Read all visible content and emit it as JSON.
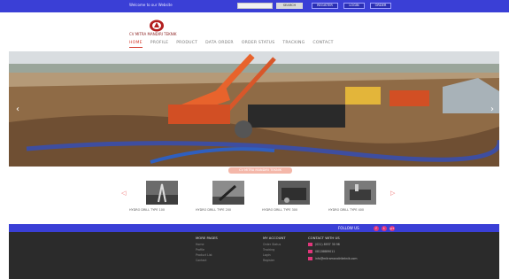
{
  "topbar": {
    "welcome": "Welcome to our Website",
    "search_placeholder": "",
    "search_button": "SEARCH",
    "links": [
      "REGISTER",
      "LOGIN",
      "ORDER"
    ]
  },
  "header": {
    "company": "CV MITRA MANDIRI TEKNIK",
    "nav": [
      "HOME",
      "PROFILE",
      "PRODUCT",
      "DATA ORDER",
      "ORDER STATUS",
      "TRACKING",
      "CONTACT"
    ]
  },
  "slider": {
    "prev_icon": "‹",
    "next_icon": "›",
    "caption": "CV MITRA MANDIRI TEKNIK"
  },
  "products": {
    "prev_icon": "◁",
    "next_icon": "▷",
    "captions": [
      "HYDRO DRILL TYPE 100",
      "HYDRO DRILL TYPE 200",
      "HYDRO DRILL TYPE 300",
      "HYDRO DRILL TYPE 400"
    ]
  },
  "follow": {
    "label": "FOLLOW US",
    "icons": [
      "f",
      "t",
      "g+"
    ]
  },
  "footer": {
    "col1": {
      "heading": "MORE PAGES",
      "links": [
        "Home",
        "Profile",
        "Product List",
        "Contact"
      ]
    },
    "col2": {
      "heading": "MY ACCOUNT",
      "links": [
        "Order Status",
        "Tracking",
        "Login",
        "Register"
      ]
    },
    "col3": {
      "heading": "CONTACT WITH US",
      "items": [
        "(021) 8937 30 96",
        "08128889011",
        "info@mitramandiriteknik.com"
      ]
    }
  },
  "colors": {
    "topbar": "#3a3fd6",
    "accent": "#d33a2c",
    "footer": "#2b2b2b",
    "social": "#e0367a"
  }
}
